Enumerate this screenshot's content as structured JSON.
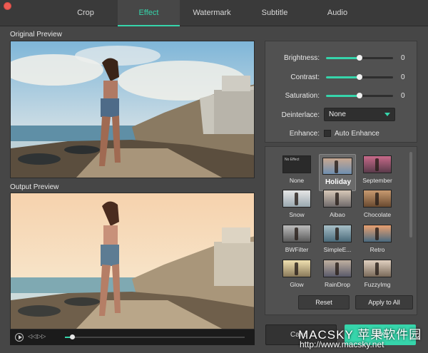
{
  "tabs": [
    {
      "label": "Crop"
    },
    {
      "label": "Effect"
    },
    {
      "label": "Watermark"
    },
    {
      "label": "Subtitle"
    },
    {
      "label": "Audio"
    }
  ],
  "active_tab": "Effect",
  "original_preview_label": "Original Preview",
  "output_preview_label": "Output Preview",
  "player": {
    "progress": 0.04
  },
  "adjustments": [
    {
      "label": "Brightness:",
      "value": "0",
      "level": 0.5
    },
    {
      "label": "Contrast:",
      "value": "0",
      "level": 0.5
    },
    {
      "label": "Saturation:",
      "value": "0",
      "level": 0.5
    }
  ],
  "deinterlace": {
    "label": "Deinterlace:",
    "value": "None"
  },
  "enhance": {
    "label": "Enhance:",
    "checkbox_label": "Auto Enhance",
    "checked": false
  },
  "effects": [
    {
      "label": "None",
      "thumb_text": "No Effect"
    },
    {
      "label": "Holiday"
    },
    {
      "label": "September"
    },
    {
      "label": "Snow"
    },
    {
      "label": "Aibao"
    },
    {
      "label": "Chocolate"
    },
    {
      "label": "BWFilter"
    },
    {
      "label": "SimpleE..."
    },
    {
      "label": "Retro"
    },
    {
      "label": "Glow"
    },
    {
      "label": "RainDrop"
    },
    {
      "label": "FuzzyImg"
    }
  ],
  "selected_effect": "Holiday",
  "buttons": {
    "reset": "Reset",
    "apply_all": "Apply to All",
    "cancel": "Canc",
    "ok": "OK"
  },
  "watermark": {
    "line1": "MACSKY 苹果软件园",
    "line2": "http://www.macsky.net"
  },
  "colors": {
    "accent": "#36d5ab",
    "background": "#464646",
    "close": "#ee5b53"
  }
}
